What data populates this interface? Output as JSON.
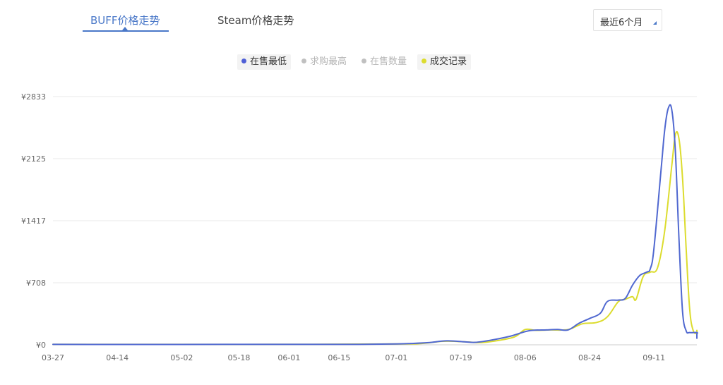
{
  "tabs": [
    {
      "label": "BUFF价格走势",
      "active": true
    },
    {
      "label": "Steam价格走势",
      "active": false
    }
  ],
  "range_select": {
    "value": "最近6个月"
  },
  "colors": {
    "accent": "#4a78c8",
    "series_low": "#5068d0",
    "series_trade": "#dcdc2e",
    "legend_off": "#c0c0c0"
  },
  "chart_data": {
    "type": "line",
    "x_ticks": [
      "03-27",
      "04-14",
      "05-02",
      "05-18",
      "06-01",
      "06-15",
      "07-01",
      "07-19",
      "08-06",
      "08-24",
      "09-11"
    ],
    "y_ticks": [
      "¥0",
      "¥708",
      "¥1417",
      "¥2125",
      "¥2833"
    ],
    "xlim": [
      "03-27",
      "09-23"
    ],
    "ylim": [
      0,
      2833
    ],
    "grid": "horizontal",
    "legend": {
      "placement": "top-center",
      "items": [
        {
          "name": "在售最低",
          "color": "#5068d0",
          "active": true
        },
        {
          "name": "求购最高",
          "color": "#c0c0c0",
          "active": false
        },
        {
          "name": "在售数量",
          "color": "#c0c0c0",
          "active": false
        },
        {
          "name": "成交记录",
          "color": "#dcdc2e",
          "active": true
        }
      ]
    },
    "series": [
      {
        "name": "在售最低",
        "color": "#5068d0",
        "points": [
          [
            "03-27",
            5
          ],
          [
            "04-10",
            4
          ],
          [
            "05-01",
            4
          ],
          [
            "05-20",
            5
          ],
          [
            "06-05",
            5
          ],
          [
            "06-20",
            5
          ],
          [
            "07-01",
            10
          ],
          [
            "07-05",
            15
          ],
          [
            "07-10",
            25
          ],
          [
            "07-15",
            45
          ],
          [
            "07-20",
            35
          ],
          [
            "07-23",
            28
          ],
          [
            "07-27",
            50
          ],
          [
            "08-02",
            100
          ],
          [
            "08-07",
            160
          ],
          [
            "08-12",
            170
          ],
          [
            "08-15",
            175
          ],
          [
            "08-18",
            170
          ],
          [
            "08-21",
            245
          ],
          [
            "08-24",
            300
          ],
          [
            "08-27",
            360
          ],
          [
            "08-29",
            495
          ],
          [
            "09-01",
            510
          ],
          [
            "09-03",
            530
          ],
          [
            "09-05",
            680
          ],
          [
            "09-07",
            790
          ],
          [
            "09-09",
            830
          ],
          [
            "09-10",
            870
          ],
          [
            "09-11",
            1100
          ],
          [
            "09-13",
            2000
          ],
          [
            "09-14",
            2450
          ],
          [
            "09-15",
            2700
          ],
          [
            "09-16",
            2680
          ],
          [
            "09-17",
            2200
          ],
          [
            "09-18",
            1200
          ],
          [
            "09-19",
            380
          ],
          [
            "09-20",
            160
          ],
          [
            "09-21",
            140
          ],
          [
            "09-23",
            140
          ],
          [
            "09-25",
            120
          ],
          [
            "09-28",
            75
          ]
        ]
      },
      {
        "name": "成交记录",
        "color": "#dcdc2e",
        "points": [
          [
            "03-27",
            5
          ],
          [
            "05-01",
            5
          ],
          [
            "06-01",
            5
          ],
          [
            "07-01",
            10
          ],
          [
            "07-08",
            15
          ],
          [
            "07-14",
            40
          ],
          [
            "07-20",
            35
          ],
          [
            "07-24",
            25
          ],
          [
            "07-28",
            40
          ],
          [
            "08-03",
            90
          ],
          [
            "08-06",
            175
          ],
          [
            "08-09",
            165
          ],
          [
            "08-13",
            170
          ],
          [
            "08-18",
            175
          ],
          [
            "08-22",
            240
          ],
          [
            "08-26",
            255
          ],
          [
            "08-29",
            320
          ],
          [
            "09-01",
            490
          ],
          [
            "09-03",
            520
          ],
          [
            "09-05",
            550
          ],
          [
            "09-06",
            520
          ],
          [
            "09-08",
            780
          ],
          [
            "09-10",
            830
          ],
          [
            "09-12",
            880
          ],
          [
            "09-14",
            1300
          ],
          [
            "09-16",
            2050
          ],
          [
            "09-17",
            2400
          ],
          [
            "09-18",
            2350
          ],
          [
            "09-19",
            1900
          ],
          [
            "09-20",
            1100
          ],
          [
            "09-21",
            400
          ],
          [
            "09-22",
            160
          ],
          [
            "09-24",
            135
          ],
          [
            "09-26",
            160
          ],
          [
            "09-28",
            165
          ],
          [
            "09-30",
            165
          ]
        ]
      }
    ]
  }
}
